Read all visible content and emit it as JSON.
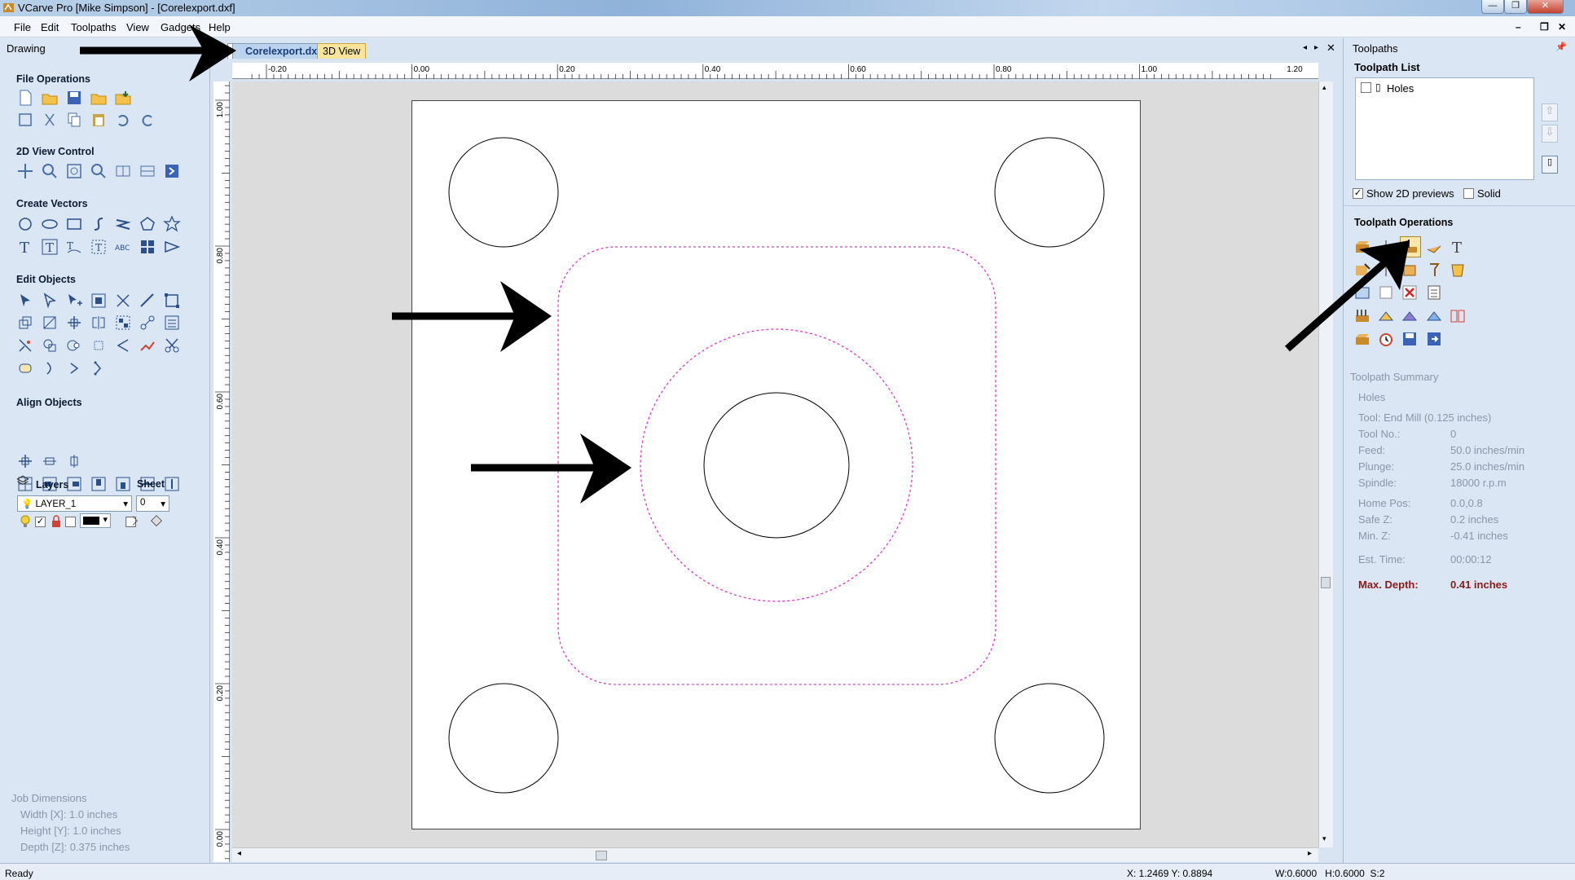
{
  "window": {
    "title": "VCarve Pro [Mike Simpson] - [Corelexport.dxf]",
    "controls": [
      "—",
      "❐",
      "✕"
    ]
  },
  "menu": {
    "items": [
      "File",
      "Edit",
      "Toolpaths",
      "View",
      "Gadgets",
      "Help"
    ],
    "mdi_controls": [
      "–",
      "❐",
      "✕"
    ]
  },
  "left_panel": {
    "title": "Drawing",
    "sections": {
      "file_operations": "File Operations",
      "view_control": "2D View Control",
      "create_vectors": "Create Vectors",
      "edit_objects": "Edit Objects",
      "align_objects": "Align Objects"
    },
    "layers": {
      "label": "Layers",
      "sheet_label": "Sheet",
      "layer_value": "LAYER_1",
      "sheet_value": "0"
    },
    "job_dimensions": {
      "title": "Job Dimensions",
      "width": "Width  [X]: 1.0 inches",
      "height": "Height [Y]: 1.0 inches",
      "depth": "Depth  [Z]: 0.375 inches"
    }
  },
  "document": {
    "tabs": [
      {
        "label": "Corelexport.dxf",
        "active": true
      },
      {
        "label": "3D View",
        "active": false
      }
    ],
    "ruler_top_labels": [
      "-0.20",
      "0.00",
      "0.20",
      "0.40",
      "0.60",
      "0.80",
      "1.00",
      "1.20"
    ],
    "ruler_left_labels": [
      "1.00",
      "0.80",
      "0.60",
      "0.40",
      "0.20",
      "0.00"
    ]
  },
  "right_panel": {
    "title": "Toolpaths",
    "toolpath_list_label": "Toolpath List",
    "toolpaths": [
      {
        "name": "Holes",
        "checked": false
      }
    ],
    "show_2d_previews": {
      "label": "Show 2D previews",
      "checked": true
    },
    "solid": {
      "label": "Solid",
      "checked": false
    },
    "operations_label": "Toolpath Operations",
    "summary": {
      "title": "Toolpath Summary",
      "name": "Holes",
      "tool": "Tool: End Mill (0.125 inches)",
      "rows": [
        {
          "label": "Tool No.:",
          "value": "0"
        },
        {
          "label": "Feed:",
          "value": "50.0 inches/min"
        },
        {
          "label": "Plunge:",
          "value": "25.0 inches/min"
        },
        {
          "label": "Spindle:",
          "value": "18000 r.p.m"
        },
        {
          "label": "Home Pos:",
          "value": "0.0,0.8"
        },
        {
          "label": "Safe Z:",
          "value": "0.2 inches"
        },
        {
          "label": "Min. Z:",
          "value": "-0.41 inches"
        },
        {
          "label": "Est. Time:",
          "value": "00:00:12"
        }
      ],
      "max_depth_label": "Max. Depth:",
      "max_depth_value": "0.41 inches"
    }
  },
  "status": {
    "ready": "Ready",
    "coords": "X: 1.2469 Y: 0.8894",
    "size": "W:0.6000   H:0.6000  S:2"
  },
  "colors": {
    "toolpath_preview": "#d63cc8",
    "annotation_arrow": "#000000",
    "max_depth": "#8b1a1a"
  }
}
